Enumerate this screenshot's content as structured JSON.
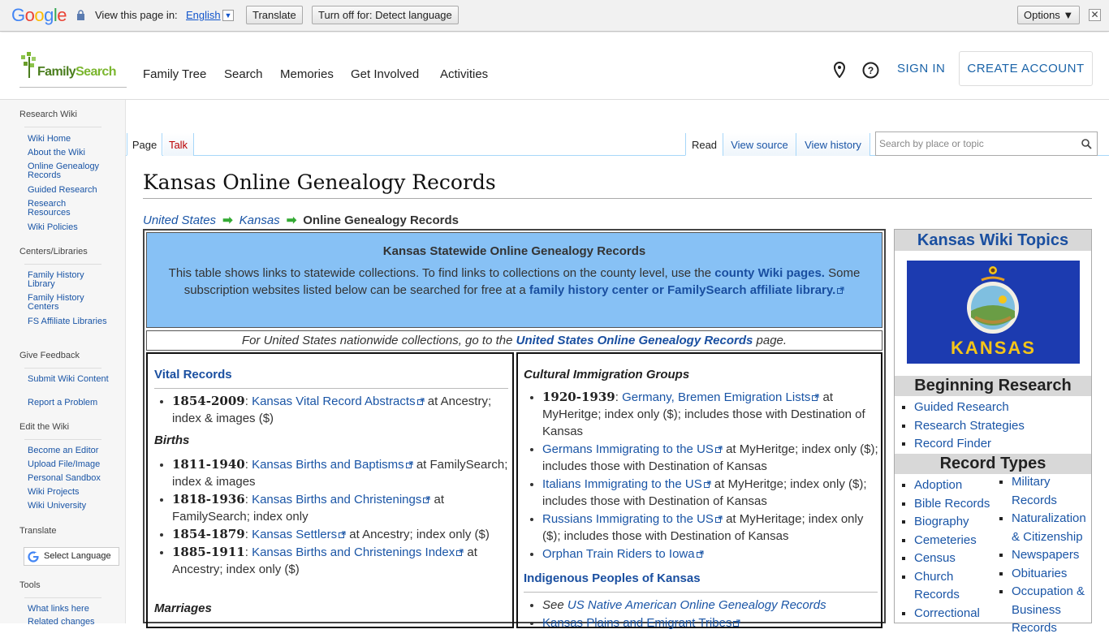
{
  "translate_bar": {
    "logo": "Google",
    "view_label": "View this page in:",
    "language": "English",
    "translate_btn": "Translate",
    "turnoff_btn": "Turn off for: Detect language",
    "options_btn": "Options ▼",
    "close": "✕"
  },
  "header": {
    "logo_text_a": "Family",
    "logo_text_b": "Search",
    "nav": [
      "Family Tree",
      "Search",
      "Memories",
      "Get Involved",
      "Activities"
    ],
    "sign_in": "SIGN IN",
    "create_account": "CREATE ACCOUNT"
  },
  "sidebar": {
    "sections": [
      {
        "title": "Research Wiki",
        "items": [
          "Wiki Home",
          "About the Wiki",
          "Online Genealogy Records",
          "Guided Research",
          "Research Resources",
          "Wiki Policies"
        ]
      },
      {
        "title": "Centers/Libraries",
        "items": [
          "Family History Library",
          "Family History Centers",
          "FS Affiliate Libraries"
        ]
      },
      {
        "title": "Give Feedback",
        "items": [
          "Submit Wiki Content",
          "Report a Problem"
        ]
      },
      {
        "title": "Edit the Wiki",
        "items": [
          "Become an Editor",
          "Upload File/Image",
          "Personal Sandbox",
          "Wiki Projects",
          "Wiki University"
        ]
      },
      {
        "title": "Translate",
        "items": []
      },
      {
        "title": "Tools",
        "items": [
          "What links here",
          "Related changes"
        ]
      }
    ],
    "select_language": "Select Language"
  },
  "tabs": {
    "page": "Page",
    "talk": "Talk",
    "read": "Read",
    "view_source": "View source",
    "view_history": "View history",
    "search_placeholder": "Search by place or topic"
  },
  "page": {
    "title": "Kansas Online Genealogy Records",
    "crumbs": [
      "United States",
      "Kansas",
      "Online Genealogy Records"
    ]
  },
  "table": {
    "blue_heading": "Kansas Statewide Online Genealogy Records",
    "blue_text_1": "This table shows links to statewide collections. To find links to collections on the county level, use the ",
    "blue_link_1": "county Wiki pages.",
    "blue_text_2": " Some subscription websites listed below can be searched for free at a ",
    "blue_link_2": "family history center or FamilySearch affiliate library.",
    "nat_text_1": "For United States nationwide collections, go to the ",
    "nat_link": "United States Online Genealogy Records",
    "nat_text_2": " page.",
    "left": {
      "vital_heading": "Vital Records",
      "vital": [
        {
          "years": "1854-2009",
          "link": "Kansas Vital Record Abstracts",
          "rest": " at Ancestry; index & images ($)"
        }
      ],
      "births_heading": "Births",
      "births": [
        {
          "years": "1811-1940",
          "link": "Kansas Births and Baptisms",
          "rest": " at FamilySearch; index & images"
        },
        {
          "years": "1818-1936",
          "link": "Kansas Births and Christenings",
          "rest": " at FamilySearch; index only"
        },
        {
          "years": "1854-1879",
          "link": "Kansas Settlers",
          "rest": " at Ancestry; index only ($)"
        },
        {
          "years": "1885-1911",
          "link": "Kansas Births and Christenings Index",
          "rest": " at Ancestry; index only ($)"
        }
      ],
      "marriages_heading": "Marriages"
    },
    "right": {
      "cultural_heading": "Cultural Immigration Groups",
      "cultural": [
        {
          "years": "1920-1939",
          "link": "Germany, Bremen Emigration Lists",
          "rest": " at MyHeritge; index only ($); includes those with Destination of Kansas"
        },
        {
          "years": "",
          "link": "Germans Immigrating to the US",
          "rest": " at MyHeritge; index only ($); includes those with Destination of Kansas"
        },
        {
          "years": "",
          "link": "Italians Immigrating to the US",
          "rest": " at MyHeritge; index only ($); includes those with Destination of Kansas"
        },
        {
          "years": "",
          "link": "Russians Immigrating to the US",
          "rest": " at MyHeritage; index only ($); includes those with Destination of Kansas"
        },
        {
          "years": "",
          "link": "Orphan Train Riders to Iowa",
          "rest": ""
        }
      ],
      "indigenous_heading": "Indigenous Peoples of Kansas",
      "see_prefix": "See ",
      "see_link": "US Native American Online Genealogy Records",
      "plains_link": "Kansas Plains and Emigrant Tribes"
    }
  },
  "rightbox": {
    "title": "Kansas Wiki Topics",
    "flag_word": "KANSAS",
    "beginning_heading": "Beginning Research",
    "beginning": [
      "Guided Research",
      "Research Strategies",
      "Record Finder"
    ],
    "record_types_heading": "Record Types",
    "record_types_left": [
      "Adoption",
      "Bible Records",
      "Biography",
      "Cemeteries",
      "Census",
      "Church Records",
      "Correctional"
    ],
    "record_types_right": [
      "Military Records",
      "Naturalization & Citizenship",
      "Newspapers",
      "Obituaries",
      "Occupation & Business Records"
    ]
  },
  "colors": {
    "link": "#1a55a6",
    "blue_panel": "#87c1f5",
    "flag": "#1c3bb0",
    "logo_green": "#7bb62f"
  }
}
